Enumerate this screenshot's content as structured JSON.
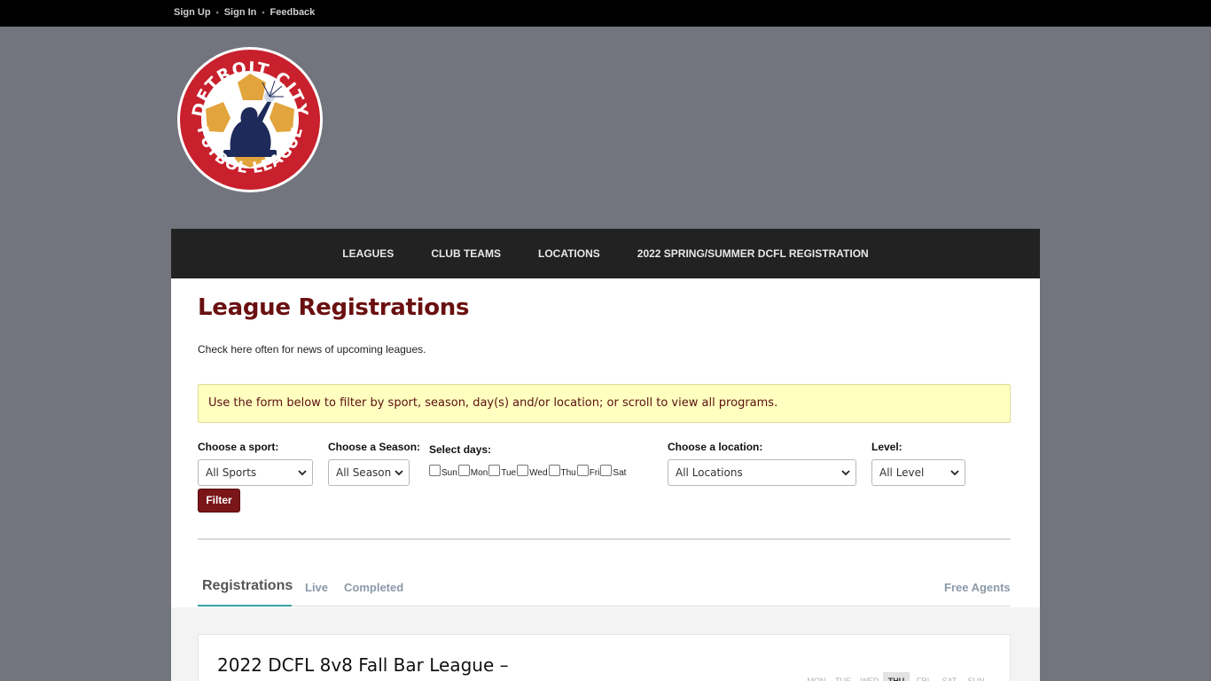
{
  "topbar": {
    "links": [
      {
        "label": "Sign Up"
      },
      {
        "label": "Sign In"
      },
      {
        "label": "Feedback"
      }
    ],
    "separator": "•"
  },
  "logo": {
    "top_text": "DETROIT CITY",
    "bottom_text": "FUTBOL LEAGUE",
    "colors": {
      "ring": "#c8202c",
      "ball": "#e2a43c",
      "figure": "#1e2a5a"
    }
  },
  "nav": {
    "items": [
      {
        "label": "LEAGUES"
      },
      {
        "label": "CLUB TEAMS"
      },
      {
        "label": "LOCATIONS"
      },
      {
        "label": "2022 SPRING/SUMMER DCFL REGISTRATION"
      }
    ]
  },
  "page": {
    "title": "League Registrations",
    "subtitle": "Check here often for news of upcoming leagues.",
    "notice": "Use the form below to filter by sport, season, day(s) and/or location; or scroll to view all programs."
  },
  "filters": {
    "sport": {
      "label": "Choose a sport:",
      "value": "All Sports"
    },
    "season": {
      "label": "Choose a Season:",
      "value": "All Season"
    },
    "days": {
      "label": "Select days:",
      "options": [
        {
          "label": "Sun"
        },
        {
          "label": "Mon"
        },
        {
          "label": "Tue"
        },
        {
          "label": "Wed"
        },
        {
          "label": "Thu"
        },
        {
          "label": "Fri"
        },
        {
          "label": "Sat"
        }
      ]
    },
    "location": {
      "label": "Choose a location:",
      "value": "All Locations"
    },
    "level": {
      "label": "Level:",
      "value": "All Level"
    },
    "filter_button": "Filter"
  },
  "tabs": {
    "registrations": "Registrations",
    "live": "Live",
    "completed": "Completed",
    "free_agents": "Free Agents"
  },
  "card": {
    "title": "2022 DCFL 8v8 Fall Bar League –",
    "weekdays": [
      {
        "label": "MON",
        "active": false
      },
      {
        "label": "TUE",
        "active": false
      },
      {
        "label": "WED",
        "active": false
      },
      {
        "label": "THU",
        "active": true
      },
      {
        "label": "FRI",
        "active": false
      },
      {
        "label": "SAT",
        "active": false
      },
      {
        "label": "SUN",
        "active": false
      }
    ]
  },
  "colors": {
    "brand_dark_red": "#6a1010",
    "button_red": "#7a1518",
    "tab_accent": "#3aa3a3",
    "notice_bg": "#ffffc0"
  }
}
